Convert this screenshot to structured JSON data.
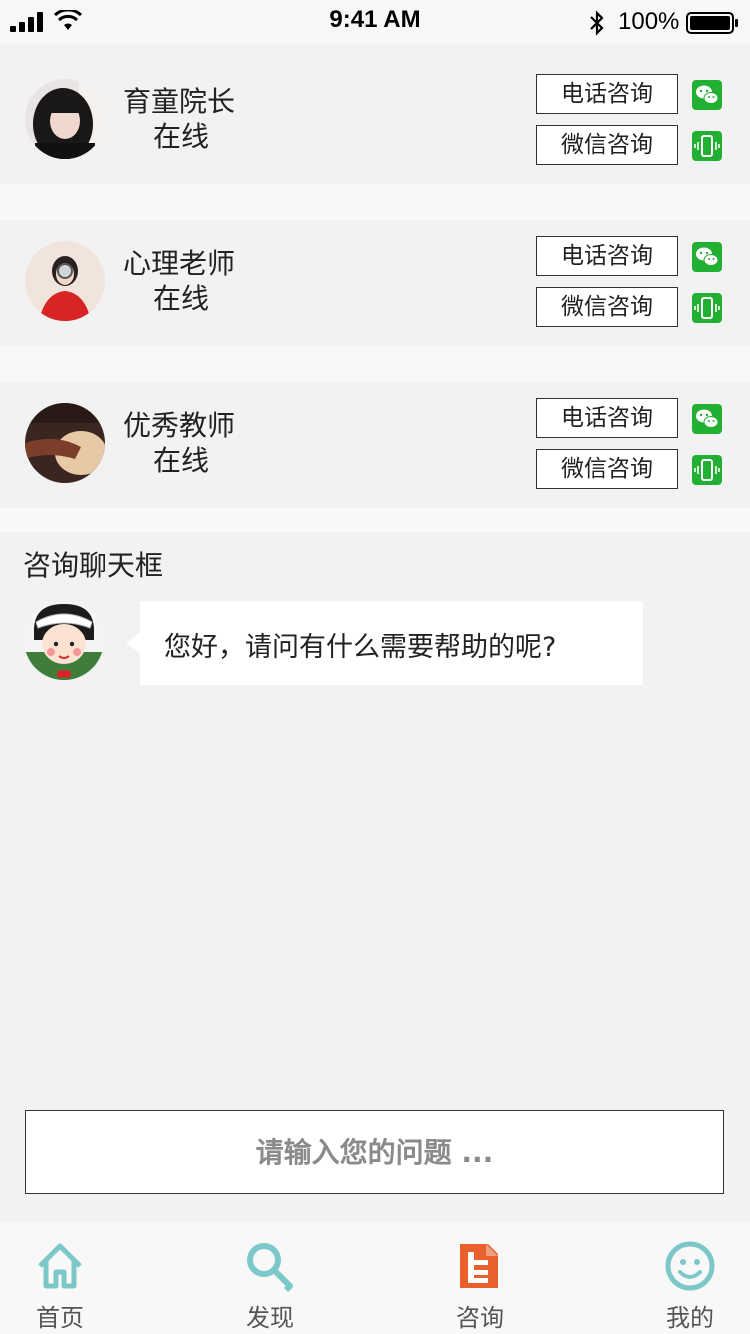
{
  "status_bar": {
    "time": "9:41 AM",
    "battery_percent": "100%"
  },
  "advisors": [
    {
      "name": "育童院长",
      "status": "在线",
      "phone_button": "电话咨询",
      "wechat_button": "微信咨询"
    },
    {
      "name": "心理老师",
      "status": "在线",
      "phone_button": "电话咨询",
      "wechat_button": "微信咨询"
    },
    {
      "name": "优秀教师",
      "status": "在线",
      "phone_button": "电话咨询",
      "wechat_button": "微信咨询"
    }
  ],
  "chat": {
    "title": "咨询聊天框",
    "messages": [
      {
        "text": "您好，请问有什么需要帮助的呢?"
      }
    ]
  },
  "input": {
    "placeholder": "请输入您的问题 ..."
  },
  "tab_bar": {
    "items": [
      {
        "label": "首页",
        "icon": "home-icon",
        "color": "#7cc8c8"
      },
      {
        "label": "发现",
        "icon": "search-icon",
        "color": "#7cc8c8"
      },
      {
        "label": "咨询",
        "icon": "document-icon",
        "color": "#e8602c"
      },
      {
        "label": "我的",
        "icon": "smiley-icon",
        "color": "#7cc8c8"
      }
    ]
  },
  "colors": {
    "accent_green": "#22b033",
    "active_tab": "#e8602c",
    "inactive_tab": "#7cc8c8"
  }
}
